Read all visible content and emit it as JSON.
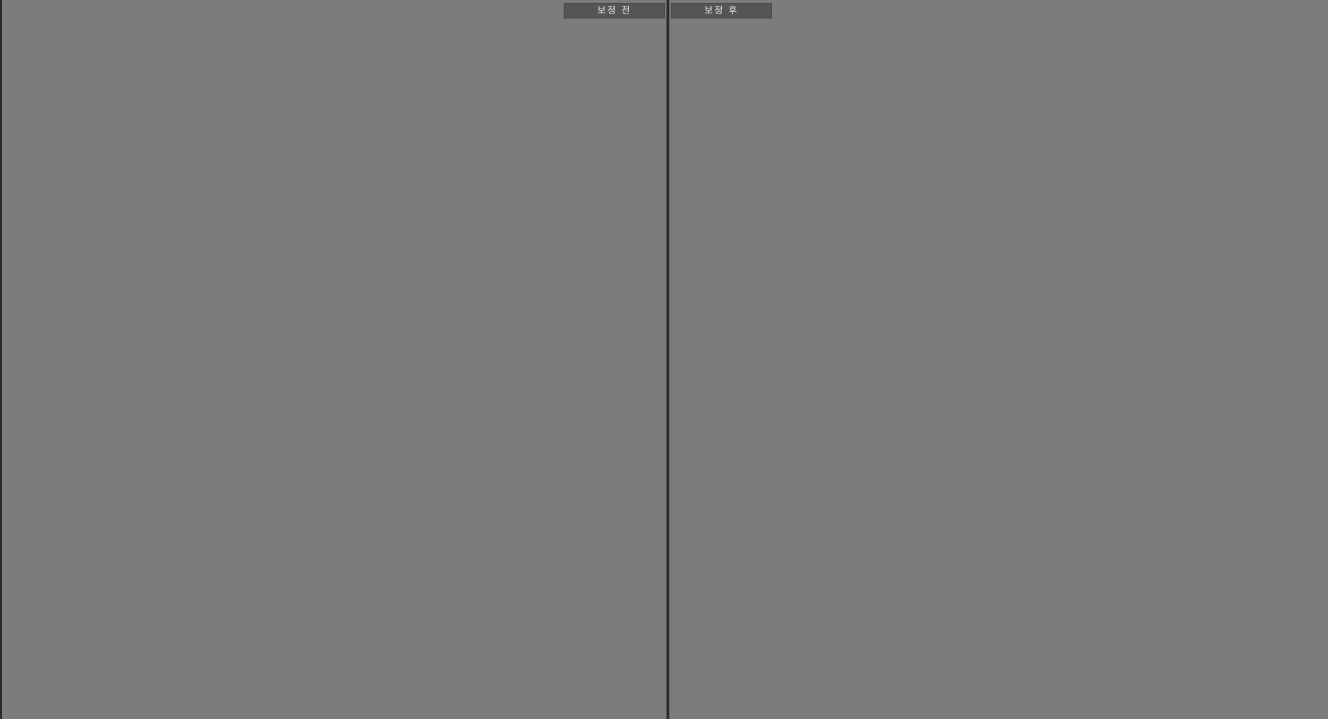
{
  "tabs": {
    "before_label": "보정 전",
    "after_label": "보정 후"
  },
  "photos": {
    "before": {
      "sky": "#f6f4f2",
      "building_left": "#c9bfc6",
      "building_right": "#b9b6b2",
      "window": "#5d6a70",
      "ground": "#3b3b3f",
      "cafe": "#211c19",
      "stairs": "#54493f",
      "sweater": "#f1e8d8",
      "hair": "#3a2620",
      "skin": "#d8ab98",
      "pants": "#9a5a5e",
      "bag": "#151515"
    },
    "after": {
      "sky": "#f4f6f3",
      "building_left": "#c2c0c3",
      "building_right": "#b6bab4",
      "window": "#4d6e6c",
      "ground": "#374445",
      "cafe": "#1a2724",
      "stairs": "#4d4b40",
      "sweater": "#f0ead9",
      "hair": "#392722",
      "skin": "#d9ae9a",
      "pants": "#9b5d5f",
      "bag": "#152020"
    }
  }
}
